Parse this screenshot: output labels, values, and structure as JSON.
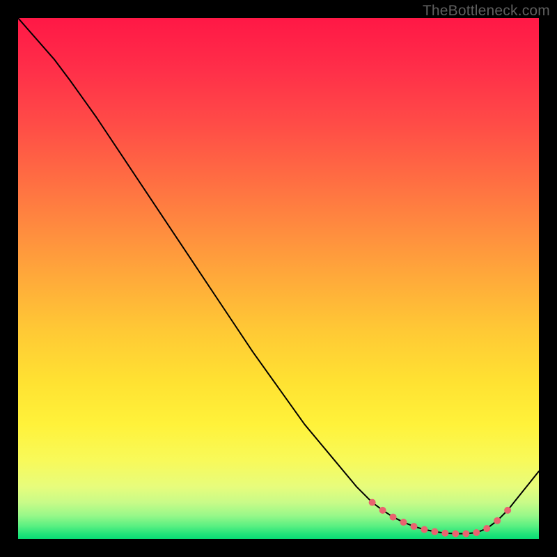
{
  "watermark": "TheBottleneck.com",
  "colors": {
    "frame": "#000000",
    "curve": "#000000",
    "marker": "#e9636f",
    "watermark": "#5f5f5f"
  },
  "chart_data": {
    "type": "line",
    "title": "",
    "xlabel": "",
    "ylabel": "",
    "xlim": [
      0,
      100
    ],
    "ylim": [
      0,
      100
    ],
    "x": [
      0,
      7,
      10,
      15,
      20,
      25,
      30,
      35,
      40,
      45,
      50,
      55,
      60,
      65,
      68,
      70,
      72,
      74,
      76,
      78,
      80,
      82,
      84,
      86,
      88,
      90,
      92,
      94,
      96,
      98,
      100
    ],
    "values": [
      100,
      92,
      88,
      81,
      73.5,
      66,
      58.5,
      51,
      43.5,
      36,
      29,
      22,
      16,
      10,
      7,
      5.5,
      4.2,
      3.2,
      2.4,
      1.8,
      1.4,
      1.1,
      1.0,
      1.0,
      1.2,
      2.0,
      3.5,
      5.5,
      8.0,
      10.5,
      13.0
    ],
    "markers_x": [
      68,
      70,
      72,
      74,
      76,
      78,
      80,
      82,
      84,
      86,
      88,
      90,
      92,
      94
    ],
    "markers_y": [
      7.0,
      5.5,
      4.2,
      3.2,
      2.4,
      1.8,
      1.4,
      1.1,
      1.0,
      1.0,
      1.2,
      2.0,
      3.5,
      5.5
    ],
    "background_gradient_stops": [
      {
        "offset": 0.0,
        "color": "#ff1846"
      },
      {
        "offset": 0.1,
        "color": "#ff2f49"
      },
      {
        "offset": 0.2,
        "color": "#ff4b47"
      },
      {
        "offset": 0.3,
        "color": "#ff6a43"
      },
      {
        "offset": 0.4,
        "color": "#ff8a3f"
      },
      {
        "offset": 0.5,
        "color": "#ffaa3a"
      },
      {
        "offset": 0.6,
        "color": "#ffc935"
      },
      {
        "offset": 0.7,
        "color": "#ffe232"
      },
      {
        "offset": 0.78,
        "color": "#fff23a"
      },
      {
        "offset": 0.85,
        "color": "#f8fa5a"
      },
      {
        "offset": 0.9,
        "color": "#e7fc7c"
      },
      {
        "offset": 0.93,
        "color": "#c8fb88"
      },
      {
        "offset": 0.955,
        "color": "#98f889"
      },
      {
        "offset": 0.975,
        "color": "#5bf082"
      },
      {
        "offset": 0.99,
        "color": "#24e47a"
      },
      {
        "offset": 1.0,
        "color": "#08dc74"
      }
    ]
  }
}
